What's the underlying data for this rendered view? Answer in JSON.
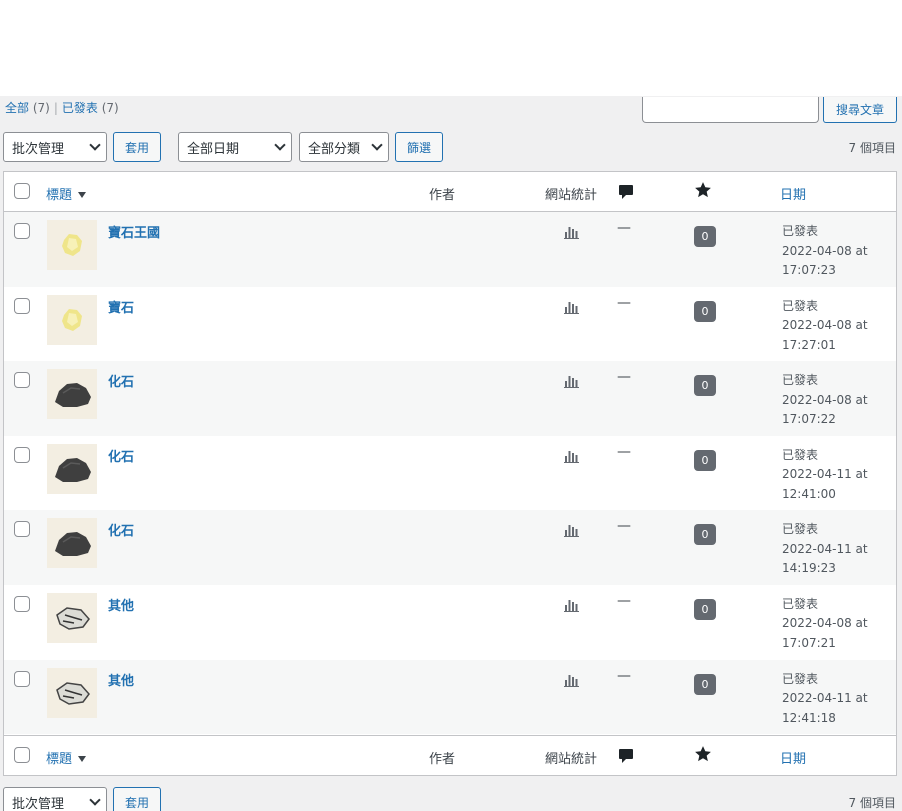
{
  "filters": {
    "all_label": "全部",
    "all_count": "(7)",
    "published_label": "已發表",
    "published_count": "(7)"
  },
  "search": {
    "placeholder": "",
    "button_label": "搜尋文章"
  },
  "toolbar_top": {
    "bulk_action": "批次管理",
    "apply_label": "套用",
    "date_filter": "全部日期",
    "category_filter": "全部分類",
    "filter_label": "篩選",
    "item_count": "7 個項目"
  },
  "toolbar_bottom": {
    "bulk_action": "批次管理",
    "apply_label": "套用",
    "item_count": "7 個項目"
  },
  "columns": {
    "title": "標題",
    "author": "作者",
    "stats": "網站統計",
    "date": "日期"
  },
  "icons": {
    "comments": "comment-bubble-icon",
    "featured": "star-icon",
    "stats": "bar-chart-icon",
    "sort": "sort-down-icon"
  },
  "rows": [
    {
      "title": "寶石王國",
      "author": "—",
      "comments": "0",
      "status": "已發表",
      "date": "2022-04-08 at",
      "time": "17:07:23",
      "thumb": "gem"
    },
    {
      "title": "寶石",
      "author": "—",
      "comments": "0",
      "status": "已發表",
      "date": "2022-04-08 at",
      "time": "17:27:01",
      "thumb": "gem"
    },
    {
      "title": "化石",
      "author": "—",
      "comments": "0",
      "status": "已發表",
      "date": "2022-04-08 at",
      "time": "17:07:22",
      "thumb": "rock"
    },
    {
      "title": "化石",
      "author": "—",
      "comments": "0",
      "status": "已發表",
      "date": "2022-04-11 at",
      "time": "12:41:00",
      "thumb": "rock"
    },
    {
      "title": "化石",
      "author": "—",
      "comments": "0",
      "status": "已發表",
      "date": "2022-04-11 at",
      "time": "14:19:23",
      "thumb": "rock"
    },
    {
      "title": "其他",
      "author": "—",
      "comments": "0",
      "status": "已發表",
      "date": "2022-04-08 at",
      "time": "17:07:21",
      "thumb": "shell"
    },
    {
      "title": "其他",
      "author": "—",
      "comments": "0",
      "status": "已發表",
      "date": "2022-04-11 at",
      "time": "12:41:18",
      "thumb": "shell"
    }
  ],
  "colors": {
    "link": "#2271b1",
    "badge": "#646970",
    "row_alt": "#f6f7f7",
    "gem": "#efe58a",
    "rock": "#3f3f3f"
  }
}
